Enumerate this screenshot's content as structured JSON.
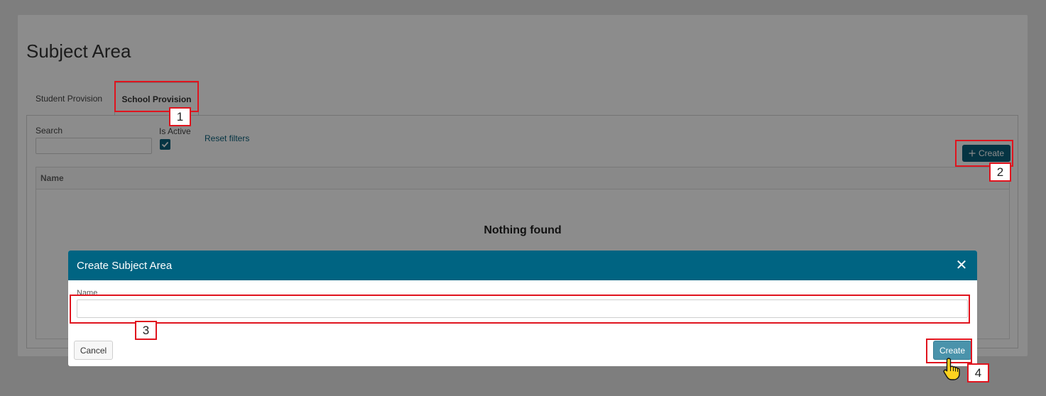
{
  "page": {
    "title": "Subject Area",
    "tabs": [
      {
        "label": "Student Provision",
        "active": false
      },
      {
        "label": "School Provision",
        "active": true
      }
    ]
  },
  "filters": {
    "search_label": "Search",
    "search_value": "",
    "is_active_label": "Is Active",
    "is_active_checked": true,
    "reset_label": "Reset filters"
  },
  "toolbar": {
    "create_label": "Create",
    "create_icon": "plus-icon"
  },
  "grid": {
    "columns": [
      "Name"
    ],
    "empty_message": "Nothing found"
  },
  "modal": {
    "title": "Create Subject Area",
    "close_icon": "close-icon",
    "name_label": "Name",
    "name_value": "",
    "cancel_label": "Cancel",
    "create_label": "Create"
  },
  "annotations": {
    "color": "#e0141e",
    "steps": [
      "1",
      "2",
      "3",
      "4"
    ]
  },
  "colors": {
    "brand": "#006482",
    "primary_button": "#0a5f7a",
    "modal_create_button": "#4a93ab"
  }
}
